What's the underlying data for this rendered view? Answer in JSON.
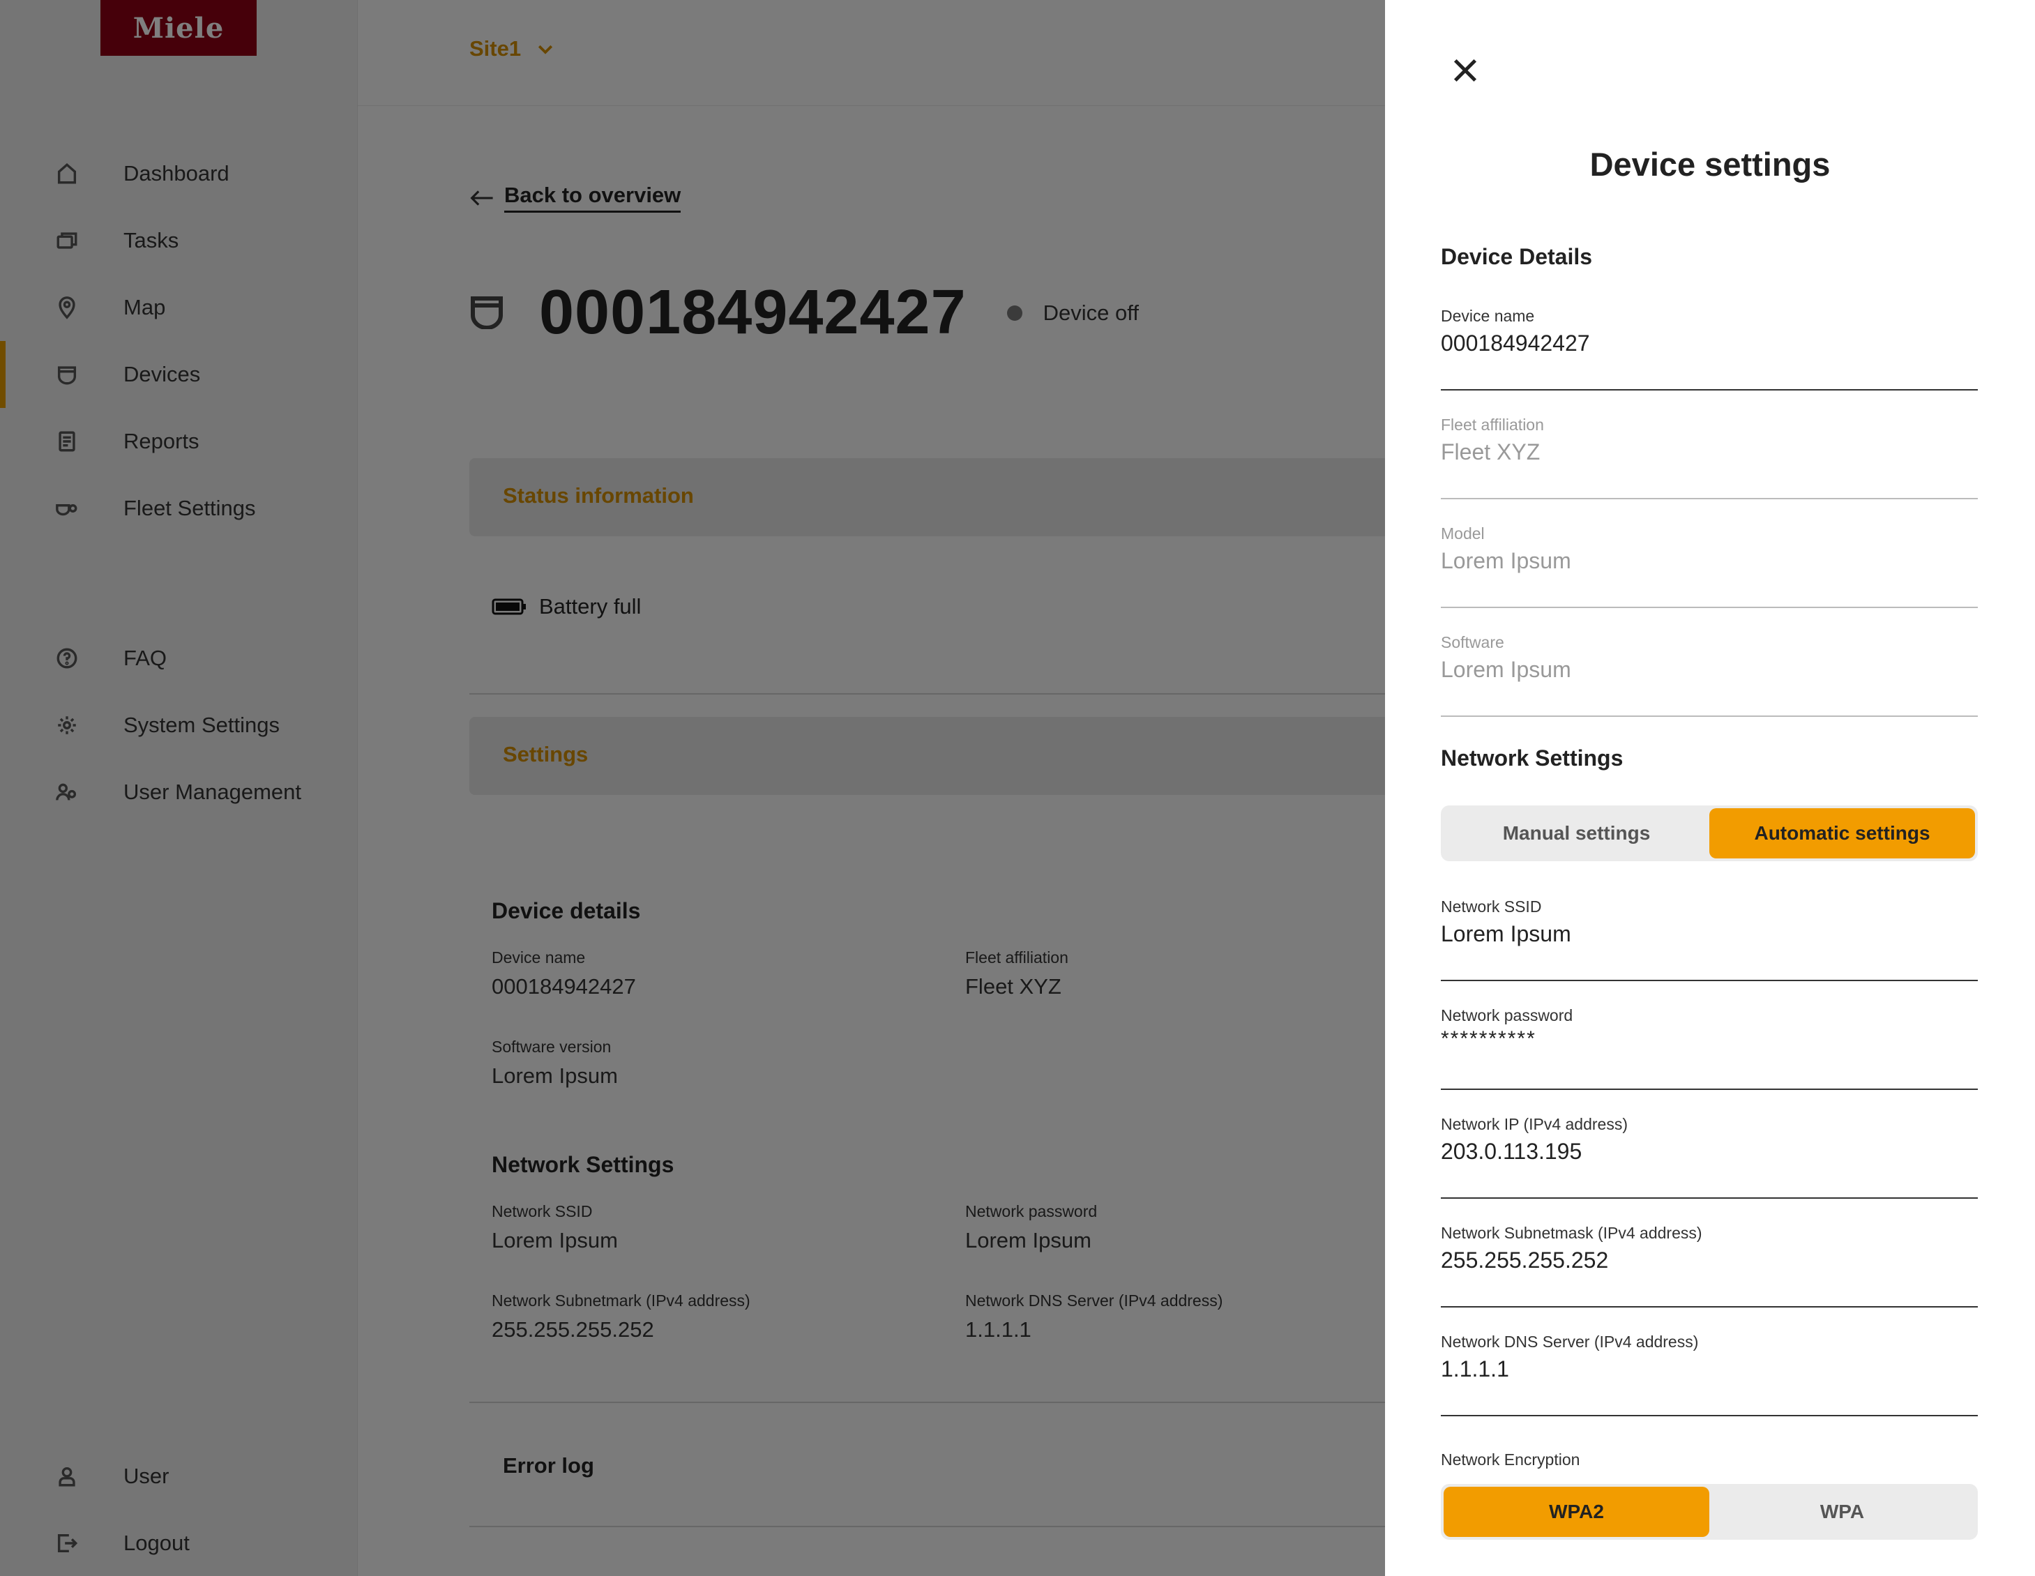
{
  "brand": {
    "logo_text": "Miele"
  },
  "sidebar": {
    "items": [
      {
        "label": "Dashboard",
        "icon": "home-icon"
      },
      {
        "label": "Tasks",
        "icon": "tasks-icon"
      },
      {
        "label": "Map",
        "icon": "map-pin-icon"
      },
      {
        "label": "Devices",
        "icon": "device-icon",
        "active": true
      },
      {
        "label": "Reports",
        "icon": "report-icon"
      },
      {
        "label": "Fleet Settings",
        "icon": "fleet-icon"
      }
    ],
    "secondary": [
      {
        "label": "FAQ",
        "icon": "question-icon"
      },
      {
        "label": "System Settings",
        "icon": "gear-icon"
      },
      {
        "label": "User Management",
        "icon": "users-icon"
      }
    ],
    "bottom": [
      {
        "label": "User",
        "icon": "user-icon"
      },
      {
        "label": "Logout",
        "icon": "logout-icon"
      }
    ]
  },
  "header": {
    "site": "Site1"
  },
  "main": {
    "back_label": "Back to overview",
    "device_id": "000184942427",
    "device_status": "Device off",
    "status_section": "Status information",
    "battery": "Battery full",
    "settings_section": "Settings",
    "details_heading": "Device details",
    "device_name_label": "Device name",
    "device_name_value": "000184942427",
    "fleet_label": "Fleet affiliation",
    "fleet_value": "Fleet XYZ",
    "software_label": "Software version",
    "software_value": "Lorem Ipsum",
    "network_heading": "Network Settings",
    "ssid_label": "Network SSID",
    "ssid_value": "Lorem Ipsum",
    "password_label": "Network password",
    "password_value": "Lorem Ipsum",
    "subnet_label": "Network Subnetmark (IPv4 address)",
    "subnet_value": "255.255.255.252",
    "dns_label": "Network DNS Server (IPv4 address)",
    "dns_value": "1.1.1.1",
    "error_log": "Error log"
  },
  "drawer": {
    "title": "Device settings",
    "details_heading": "Device Details",
    "fields": {
      "device_name": {
        "label": "Device name",
        "value": "000184942427"
      },
      "fleet": {
        "label": "Fleet affiliation",
        "value": "Fleet XYZ"
      },
      "model": {
        "label": "Model",
        "value": "Lorem Ipsum"
      },
      "software": {
        "label": "Software",
        "value": "Lorem Ipsum"
      }
    },
    "network_heading": "Network Settings",
    "mode_options": {
      "manual": "Manual settings",
      "automatic": "Automatic settings",
      "selected": "automatic"
    },
    "network": {
      "ssid": {
        "label": "Network SSID",
        "value": "Lorem Ipsum"
      },
      "password": {
        "label": "Network password",
        "value": "**********"
      },
      "ip": {
        "label": "Network IP (IPv4 address)",
        "value": "203.0.113.195"
      },
      "subnet": {
        "label": "Network Subnetmask (IPv4 address)",
        "value": "255.255.255.252"
      },
      "dns": {
        "label": "Network DNS Server (IPv4 address)",
        "value": "1.1.1.1"
      }
    },
    "encryption_label": "Network Encryption",
    "encryption_options": {
      "wpa2": "WPA2",
      "wpa": "WPA",
      "selected": "wpa2"
    }
  },
  "colors": {
    "accent": "#f29c00",
    "brand": "#8c0014",
    "accent_text": "#d08c00"
  }
}
